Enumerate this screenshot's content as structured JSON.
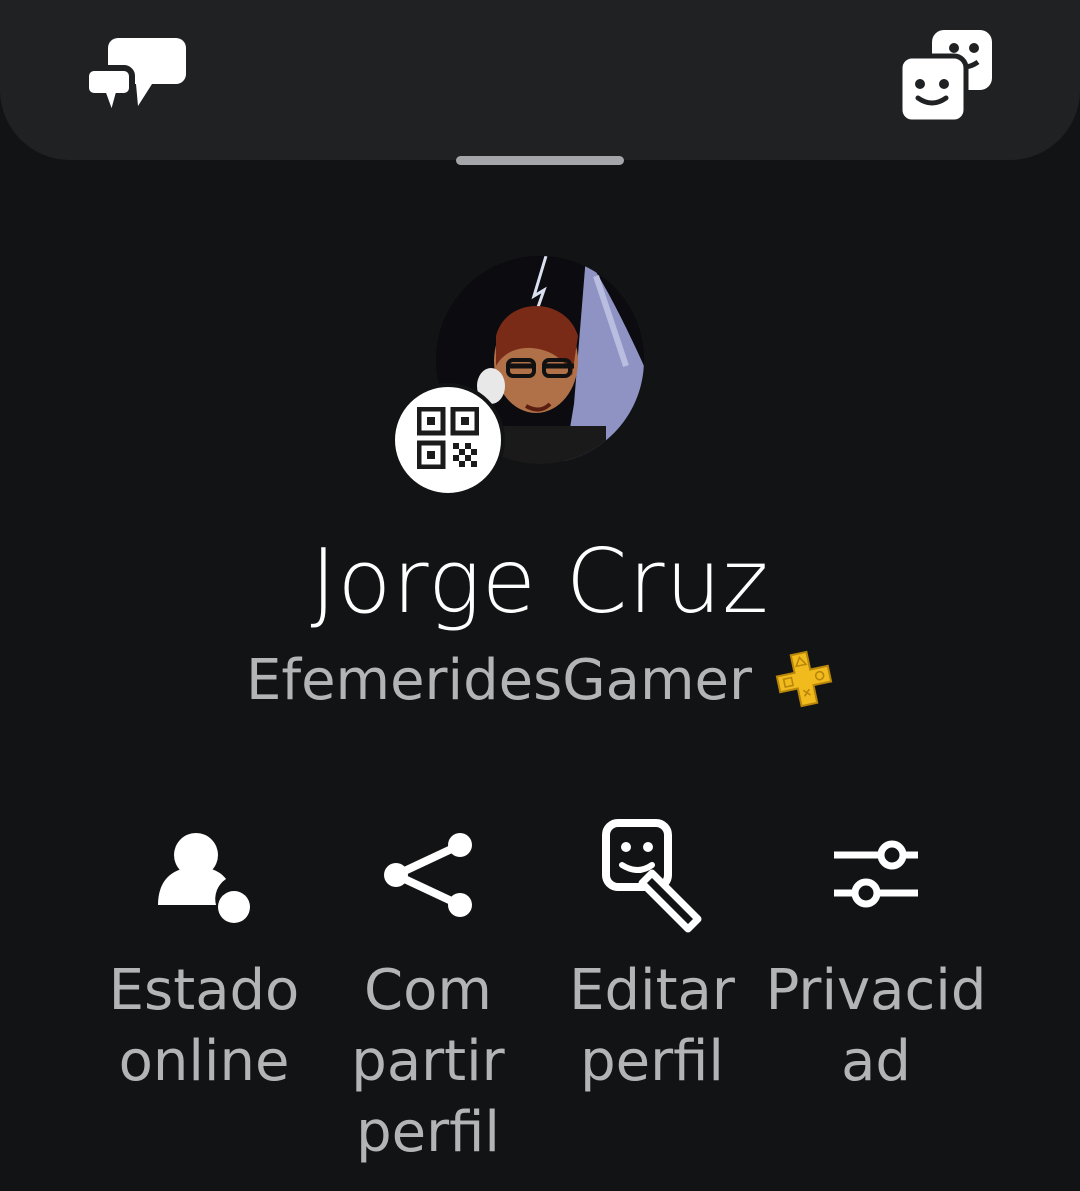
{
  "header": {
    "left_icon": "chat-bubbles-icon",
    "right_icon": "friends-faces-icon"
  },
  "profile": {
    "display_name": "Jorge Cruz",
    "online_id": "EfemeridesGamer",
    "badge_icon": "ps-plus-icon",
    "qr_icon": "qr-code-icon",
    "accent_color": "#f5c518"
  },
  "actions": [
    {
      "label": "Estado\nonline",
      "icon": "user-status-icon"
    },
    {
      "label": "Com\npartir\nperfil",
      "icon": "share-icon"
    },
    {
      "label": "Editar\nperfil",
      "icon": "edit-avatar-icon"
    },
    {
      "label": "Privacid\nad",
      "icon": "sliders-icon"
    }
  ]
}
